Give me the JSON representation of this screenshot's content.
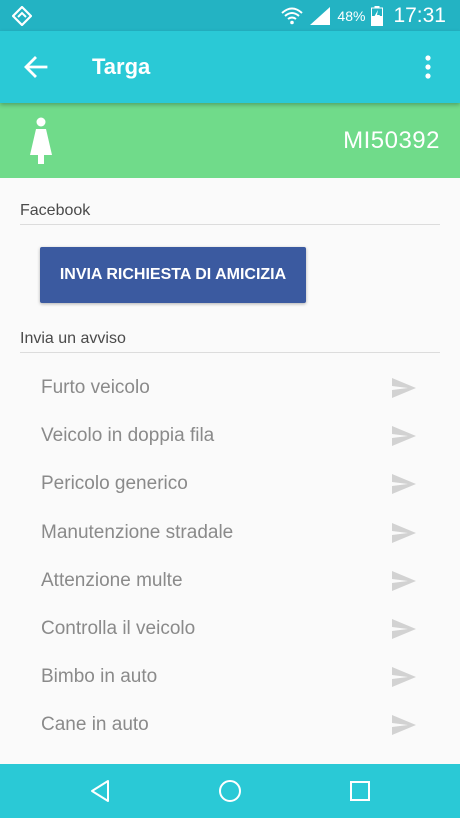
{
  "status_bar": {
    "battery_percent": "48%",
    "time": "17:31"
  },
  "app_bar": {
    "title": "Targa",
    "back_icon": "arrow-left-icon",
    "menu_icon": "more-vert-icon"
  },
  "plate_bar": {
    "icon": "person-icon",
    "plate": "MI50392",
    "color": "#70db8a"
  },
  "facebook": {
    "header": "Facebook",
    "button_label": "INVIA RICHIESTA DI AMICIZIA",
    "button_color": "#3b5aa0"
  },
  "alerts": {
    "header": "Invia un avviso",
    "items": [
      {
        "label": "Furto veicolo"
      },
      {
        "label": "Veicolo in doppia fila"
      },
      {
        "label": "Pericolo generico"
      },
      {
        "label": "Manutenzione stradale"
      },
      {
        "label": "Attenzione multe"
      },
      {
        "label": "Controlla il veicolo"
      },
      {
        "label": "Bimbo in auto"
      },
      {
        "label": "Cane in auto"
      }
    ],
    "send_icon": "send-icon"
  },
  "colors": {
    "primary": "#2ac9d6",
    "primary_dark": "#23b3c3",
    "accent_green": "#70db8a"
  }
}
